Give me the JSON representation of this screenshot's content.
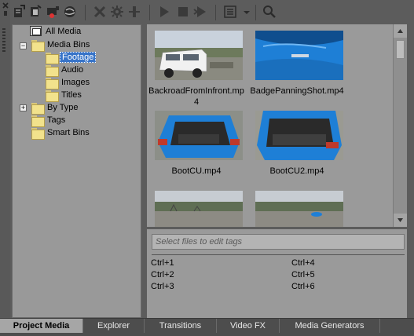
{
  "toolbar": {
    "buttons": [
      {
        "name": "import-media-icon"
      },
      {
        "name": "capture-video-icon"
      },
      {
        "name": "get-media-from-web-icon"
      },
      {
        "name": "get-photos-icon"
      },
      {
        "name": "remove-media-icon"
      },
      {
        "name": "media-fx-icon"
      },
      {
        "name": "properties-icon"
      },
      {
        "name": "play-icon"
      },
      {
        "name": "stop-icon"
      },
      {
        "name": "auto-preview-icon"
      },
      {
        "name": "views-icon"
      },
      {
        "name": "search-icon"
      }
    ]
  },
  "tree": {
    "all_media": "All Media",
    "media_bins": "Media Bins",
    "footage": "Footage",
    "audio": "Audio",
    "images": "Images",
    "titles": "Titles",
    "by_type": "By Type",
    "tags": "Tags",
    "smart_bins": "Smart Bins",
    "collapse_glyph": "−",
    "expand_glyph": "+"
  },
  "media": {
    "items": [
      {
        "name": "BackroadFromInfront.mp4",
        "thumb": "white-van"
      },
      {
        "name": "BadgePanningShot.mp4",
        "thumb": "blue-car-badge"
      },
      {
        "name": "BootCU.mp4",
        "thumb": "open-boot"
      },
      {
        "name": "BootCU2.mp4",
        "thumb": "open-boot-2"
      },
      {
        "name": "",
        "thumb": "gravel-lot"
      },
      {
        "name": "",
        "thumb": "gravel-lot-car"
      }
    ]
  },
  "tags": {
    "placeholder": "Select files to edit tags",
    "shortcuts": [
      "Ctrl+1",
      "Ctrl+2",
      "Ctrl+3",
      "Ctrl+4",
      "Ctrl+5",
      "Ctrl+6"
    ]
  },
  "tabs": [
    {
      "label": "Project Media",
      "active": true
    },
    {
      "label": "Explorer",
      "active": false
    },
    {
      "label": "Transitions",
      "active": false
    },
    {
      "label": "Video FX",
      "active": false
    },
    {
      "label": "Media Generators",
      "active": false
    }
  ],
  "colors": {
    "panel_bg": "#999999",
    "chrome_bg": "#5c5c5c",
    "selection": "#3874c8",
    "folder": "#f2e28c",
    "car_blue": "#1e7fd6"
  }
}
